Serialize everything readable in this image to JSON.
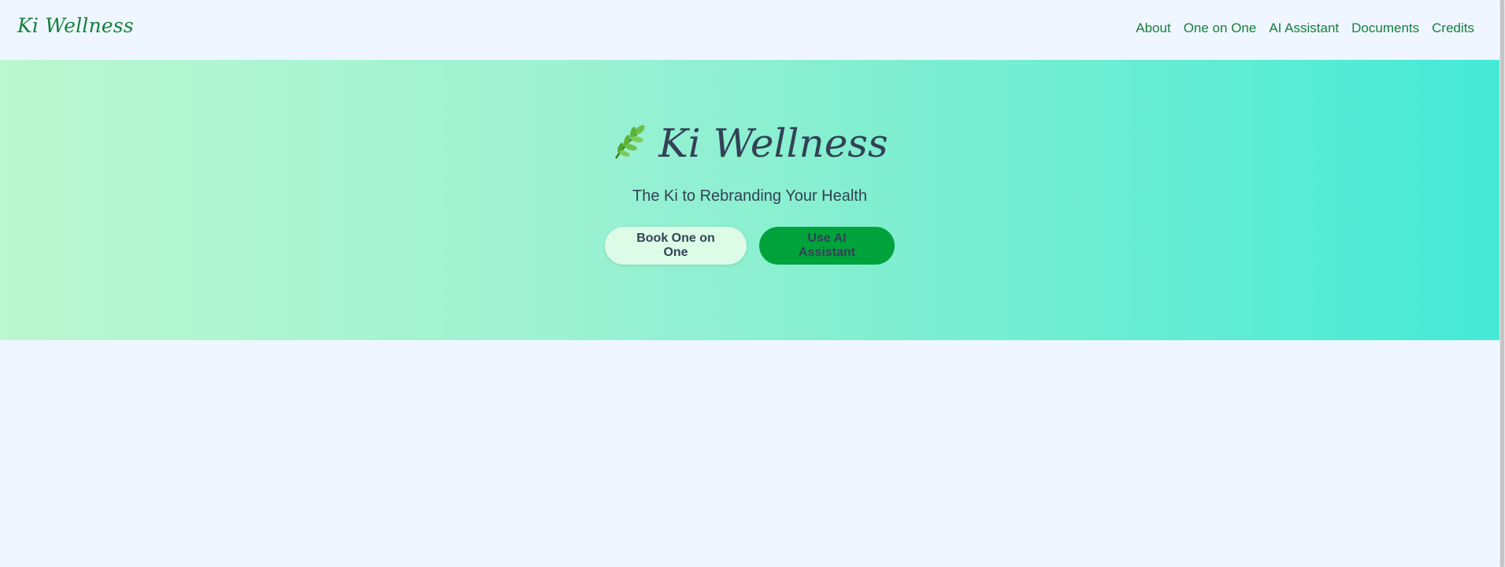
{
  "header": {
    "brand": "Ki Wellness",
    "nav": [
      {
        "label": "About"
      },
      {
        "label": "One on One"
      },
      {
        "label": "AI Assistant"
      },
      {
        "label": "Documents"
      },
      {
        "label": "Credits"
      }
    ]
  },
  "hero": {
    "icon": "herb-leaf-icon",
    "title": "Ki Wellness",
    "tagline": "The Ki to Rebranding Your Health",
    "buttons": {
      "primary_label": "Book One on One",
      "secondary_label": "Use AI Assistant"
    }
  },
  "colors": {
    "brand_green": "#15803d",
    "button_green": "#00a33b",
    "button_light": "#dcfce7",
    "page_bg": "#eff6ff",
    "gradient_start": "#bbf7d0",
    "gradient_end": "#45ead6",
    "text_dark": "#334155"
  }
}
